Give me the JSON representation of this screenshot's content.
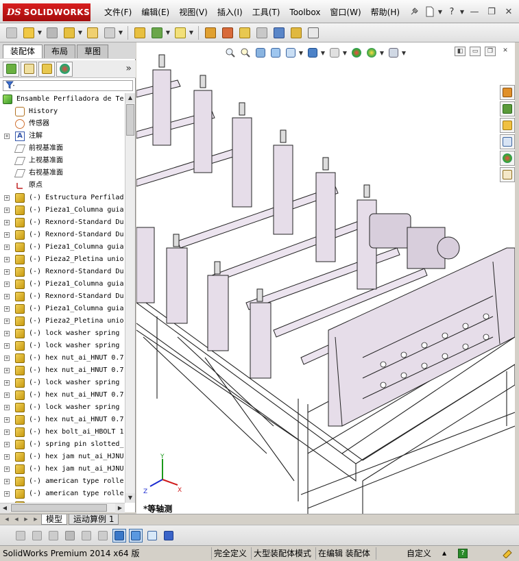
{
  "app": {
    "brand_ds": "DS",
    "brand_name": "SOLIDWORKS"
  },
  "menu": [
    "文件(F)",
    "编辑(E)",
    "视图(V)",
    "插入(I)",
    "工具(T)",
    "Toolbox",
    "窗口(W)",
    "帮助(H)"
  ],
  "title_controls": {
    "help": "?",
    "minimize": "—",
    "restore": "❐",
    "close": "✕"
  },
  "left_tabs": [
    "装配体",
    "布局",
    "草图"
  ],
  "panel": {
    "more": "»",
    "filter_icon": "filter-icon"
  },
  "tree": [
    {
      "label": "Ensamble Perfiladora de Te",
      "icon": "assembly",
      "level": 0,
      "expand": ""
    },
    {
      "label": "History",
      "icon": "history",
      "level": 1,
      "expand": ""
    },
    {
      "label": "传感器",
      "icon": "sensor",
      "level": 1,
      "expand": ""
    },
    {
      "label": "注解",
      "icon": "annotation",
      "level": 1,
      "expand": "+"
    },
    {
      "label": "前视基准面",
      "icon": "plane",
      "level": 1,
      "expand": ""
    },
    {
      "label": "上视基准面",
      "icon": "plane",
      "level": 1,
      "expand": ""
    },
    {
      "label": "右视基准面",
      "icon": "plane",
      "level": 1,
      "expand": ""
    },
    {
      "label": "原点",
      "icon": "origin",
      "level": 1,
      "expand": ""
    },
    {
      "label": "(-) Estructura Perfilad",
      "icon": "part",
      "level": 1,
      "expand": "+"
    },
    {
      "label": "(-) Pieza1_Columna guia",
      "icon": "part",
      "level": 1,
      "expand": "+"
    },
    {
      "label": "(-) Rexnord-Standard Du",
      "icon": "part",
      "level": 1,
      "expand": "+"
    },
    {
      "label": "(-) Rexnord-Standard Du",
      "icon": "part",
      "level": 1,
      "expand": "+"
    },
    {
      "label": "(-) Pieza1_Columna guia",
      "icon": "part",
      "level": 1,
      "expand": "+"
    },
    {
      "label": "(-) Pieza2_Pletina unio",
      "icon": "part",
      "level": 1,
      "expand": "+"
    },
    {
      "label": "(-) Rexnord-Standard Du",
      "icon": "part",
      "level": 1,
      "expand": "+"
    },
    {
      "label": "(-) Pieza1_Columna guia",
      "icon": "part",
      "level": 1,
      "expand": "+"
    },
    {
      "label": "(-) Rexnord-Standard Du",
      "icon": "part",
      "level": 1,
      "expand": "+"
    },
    {
      "label": "(-) Pieza1_Columna guia",
      "icon": "part",
      "level": 1,
      "expand": "+"
    },
    {
      "label": "(-) Pieza2_Pletina unio",
      "icon": "part",
      "level": 1,
      "expand": "+"
    },
    {
      "label": "(-) lock washer spring",
      "icon": "part",
      "level": 1,
      "expand": "+"
    },
    {
      "label": "(-) lock washer spring",
      "icon": "part",
      "level": 1,
      "expand": "+"
    },
    {
      "label": "(-) hex nut_ai_HNUT 0.7",
      "icon": "part",
      "level": 1,
      "expand": "+"
    },
    {
      "label": "(-) hex nut_ai_HNUT 0.7",
      "icon": "part",
      "level": 1,
      "expand": "+"
    },
    {
      "label": "(-) lock washer spring",
      "icon": "part",
      "level": 1,
      "expand": "+"
    },
    {
      "label": "(-) hex nut_ai_HNUT 0.7",
      "icon": "part",
      "level": 1,
      "expand": "+"
    },
    {
      "label": "(-) lock washer spring",
      "icon": "part",
      "level": 1,
      "expand": "+"
    },
    {
      "label": "(-) hex nut_ai_HNUT 0.7",
      "icon": "part",
      "level": 1,
      "expand": "+"
    },
    {
      "label": "(-) hex bolt_ai_HBOLT 1",
      "icon": "part",
      "level": 1,
      "expand": "+"
    },
    {
      "label": "(-) spring pin slotted_",
      "icon": "part",
      "level": 1,
      "expand": "+"
    },
    {
      "label": "(-) hex jam nut_ai_HJNU",
      "icon": "part",
      "level": 1,
      "expand": "+"
    },
    {
      "label": "(-) hex jam nut_ai_HJNU",
      "icon": "part",
      "level": 1,
      "expand": "+"
    },
    {
      "label": "(-) american type rolle",
      "icon": "part",
      "level": 1,
      "expand": "+"
    },
    {
      "label": "(-) american type rolle",
      "icon": "part",
      "level": 1,
      "expand": "+"
    },
    {
      "label": "",
      "icon": "part",
      "level": 1,
      "expand": "+"
    }
  ],
  "viewport": {
    "view_name": "*等轴测",
    "triad": {
      "x": "X",
      "y": "Y",
      "z": "Z"
    }
  },
  "bottom_tabs": [
    "模型",
    "运动算例 1"
  ],
  "status": {
    "product": "SolidWorks Premium 2014 x64 版",
    "definition": "完全定义",
    "mode": "大型装配体模式",
    "editing": "在编辑 装配体",
    "units": "自定义",
    "units_arrow": "▲",
    "help": "?"
  },
  "colors": {
    "brand_red": "#c8161d",
    "model_fill": "#e6dde9",
    "model_shade": "#b9a9bf",
    "model_edge": "#222222",
    "frame_fill": "#f2f2f2"
  }
}
